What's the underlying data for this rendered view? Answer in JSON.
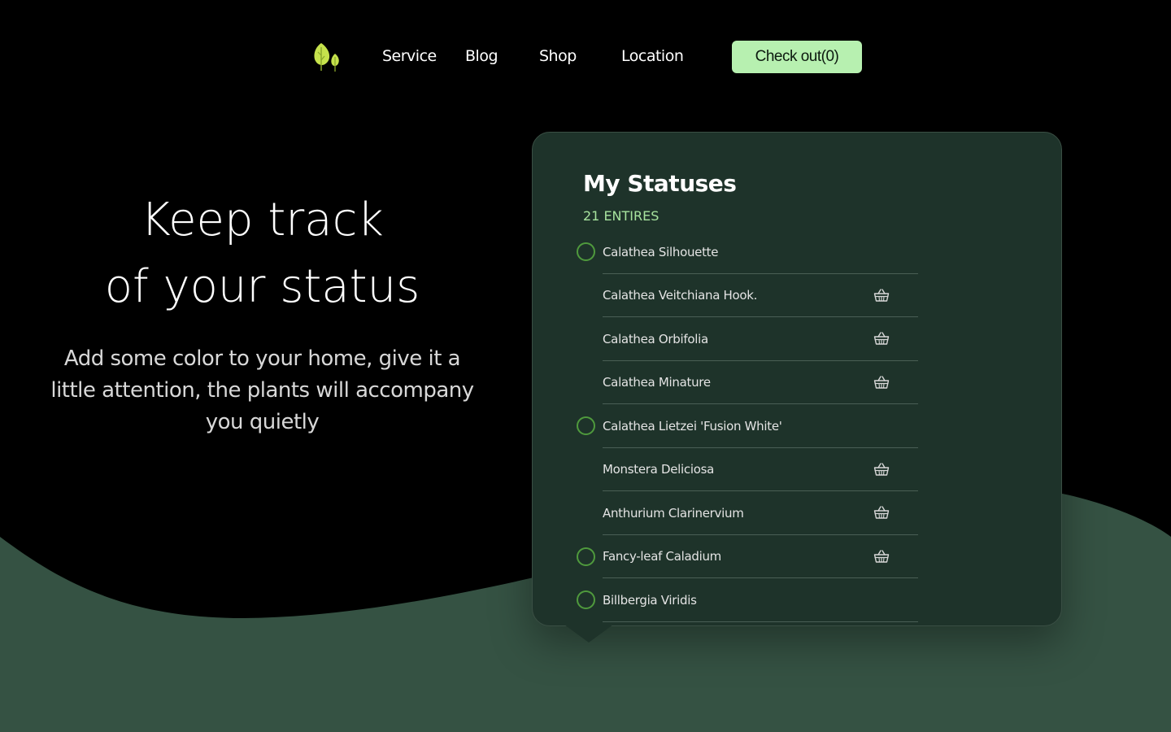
{
  "nav": {
    "links": [
      "Service",
      "Blog",
      "Shop",
      "Location"
    ],
    "checkout_label": "Check out(0)"
  },
  "hero": {
    "title_line1": "Keep track",
    "title_line2": "of your status",
    "subtitle": "Add some color to your home, give it a little attention, the plants will accompany you quietly"
  },
  "card": {
    "title": "My Statuses",
    "count": "21 ENTIRES",
    "items": [
      {
        "label": "Calathea Silhouette",
        "has_status": true,
        "has_basket": false
      },
      {
        "label": "Calathea Veitchiana Hook.",
        "has_status": false,
        "has_basket": true
      },
      {
        "label": "Calathea Orbifolia",
        "has_status": false,
        "has_basket": true
      },
      {
        "label": "Calathea Minature",
        "has_status": false,
        "has_basket": true
      },
      {
        "label": "Calathea Lietzei 'Fusion White'",
        "has_status": true,
        "has_basket": false
      },
      {
        "label": "Monstera Deliciosa",
        "has_status": false,
        "has_basket": true
      },
      {
        "label": "Anthurium Clarinervium",
        "has_status": false,
        "has_basket": true
      },
      {
        "label": "Fancy-leaf Caladium",
        "has_status": true,
        "has_basket": true
      },
      {
        "label": "Billbergia Viridis",
        "has_status": true,
        "has_basket": false
      }
    ]
  },
  "colors": {
    "background": "#000000",
    "wave": "#355243",
    "card": "#1e332a",
    "accent": "#b7f0b0",
    "status_ring": "#4f9a3d",
    "count_text": "#a7e39e"
  }
}
